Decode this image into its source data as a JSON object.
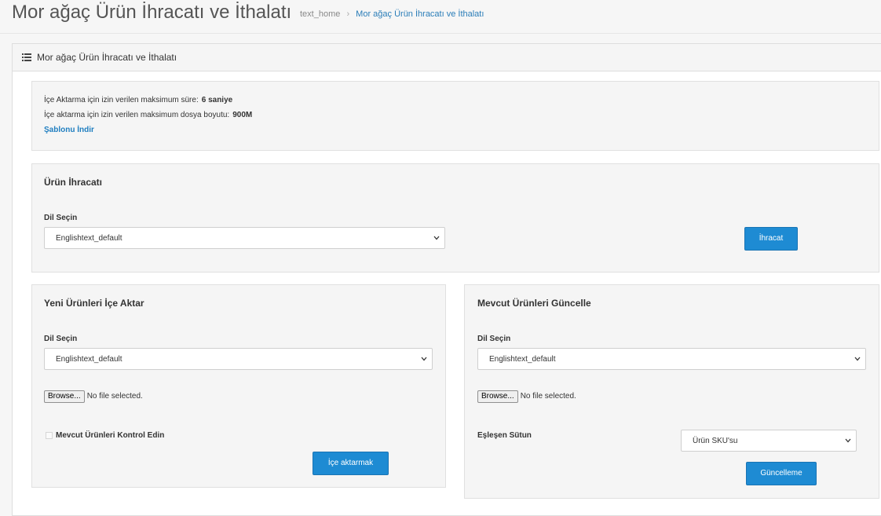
{
  "header": {
    "title": "Mor ağaç Ürün İhracatı ve İthalatı",
    "breadcrumb_home": "text_home",
    "breadcrumb_separator": "›",
    "breadcrumb_current": "Mor ağaç Ürün İhracatı ve İthalatı"
  },
  "panel": {
    "heading": "Mor ağaç Ürün İhracatı ve İthalatı",
    "icon": "list-icon"
  },
  "info": {
    "max_time_label": "İçe Aktarma için izin verilen maksimum süre:",
    "max_time_value": "6 saniye",
    "max_size_label": "İçe aktarma için izin verilen maksimum dosya boyutu:",
    "max_size_value": "900M",
    "template_link": "Şablonu İndir"
  },
  "export_section": {
    "title": "Ürün İhracatı",
    "language_label": "Dil Seçin",
    "language_value": "Englishtext_default",
    "button": "İhracat"
  },
  "import_section": {
    "title": "Yeni Ürünleri İçe Aktar",
    "language_label": "Dil Seçin",
    "language_value": "Englishtext_default",
    "browse_label": "Browse...",
    "file_status": "No file selected.",
    "checkbox_label": "Mevcut Ürünleri Kontrol Edin",
    "checkbox_checked": false,
    "button": "İçe aktarmak"
  },
  "update_section": {
    "title": "Mevcut Ürünleri Güncelle",
    "language_label": "Dil Seçin",
    "language_value": "Englishtext_default",
    "browse_label": "Browse...",
    "file_status": "No file selected.",
    "match_label": "Eşleşen Sütun",
    "match_value": "Ürün SKU'su",
    "button": "Güncelleme"
  },
  "colors": {
    "primary_button": "#1e8bd3",
    "link": "#1f7ec0",
    "breadcrumb_active": "#2a7db8"
  }
}
